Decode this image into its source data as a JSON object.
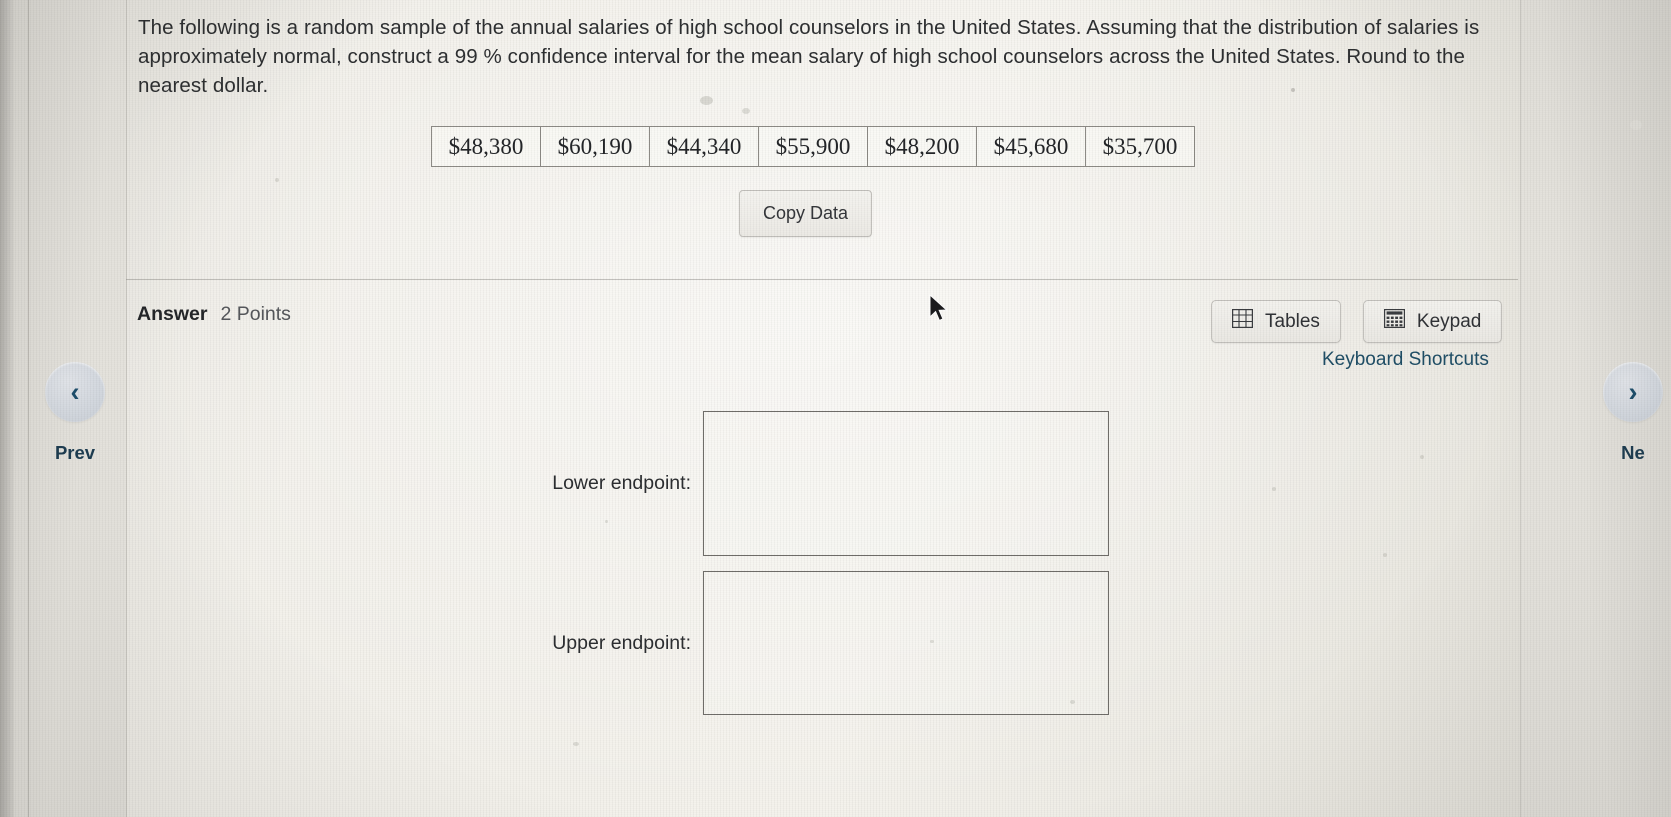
{
  "question": {
    "text": "The following is a random sample of the annual salaries of high school counselors in the United States. Assuming that the distribution of salaries is approximately normal, construct a 99 %  confidence interval for the mean salary of high school counselors across the United States. Round to the nearest dollar."
  },
  "data_table": {
    "values": [
      "$48,380",
      "$60,190",
      "$44,340",
      "$55,900",
      "$48,200",
      "$45,680",
      "$35,700"
    ]
  },
  "copy_button": {
    "label": "Copy Data"
  },
  "answer": {
    "label": "Answer",
    "points": "2 Points"
  },
  "tools": {
    "tables_label": "Tables",
    "keypad_label": "Keypad",
    "keyboard_shortcuts_label": "Keyboard Shortcuts"
  },
  "fields": [
    {
      "label": "Lower endpoint:",
      "value": "",
      "placeholder": ""
    },
    {
      "label": "Upper endpoint:",
      "value": "",
      "placeholder": ""
    }
  ],
  "nav": {
    "prev_label": "Prev",
    "prev_icon": "chevron-left-icon",
    "next_label": "Ne",
    "next_icon": "chevron-right-icon"
  },
  "colors": {
    "link": "#1f4e66",
    "nav_text": "#1d3d52",
    "page_bg": "#f1efe9",
    "border": "#8d8b86"
  }
}
